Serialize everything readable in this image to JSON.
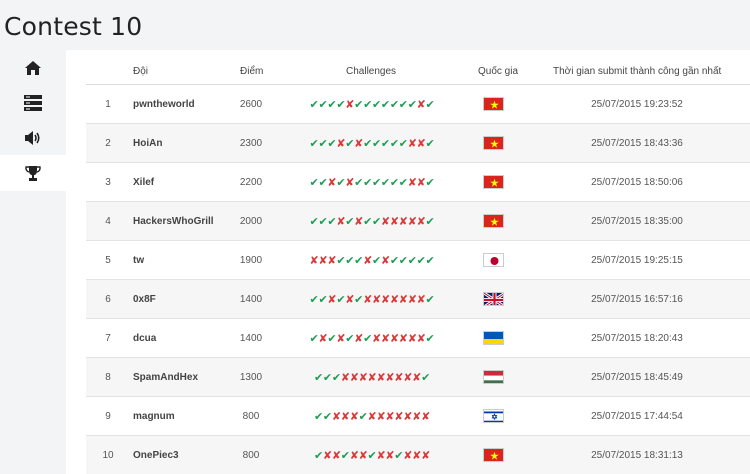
{
  "page": {
    "title": "Contest 10"
  },
  "sidebar": {
    "items": [
      {
        "icon": "home-icon",
        "active": false
      },
      {
        "icon": "server-icon",
        "active": false
      },
      {
        "icon": "speaker-icon",
        "active": false
      },
      {
        "icon": "trophy-icon",
        "active": true
      }
    ]
  },
  "scoreboard": {
    "headers": {
      "team": "Đội",
      "score": "Điểm",
      "challenges": "Challenges",
      "country": "Quốc gia",
      "last_submit": "Thời gian submit thành công gần nhất"
    },
    "rows": [
      {
        "rank": "1",
        "team": "pwntheworld",
        "score": "2600",
        "challenges": "✔✔✔✔✘✔✔✔✔✔✔✔✘✔",
        "country_flag": "vietnam",
        "time": "25/07/2015 19:23:52"
      },
      {
        "rank": "2",
        "team": "HoiAn",
        "score": "2300",
        "challenges": "✔✔✔✘✔✘✔✔✔✔✔✘✘✔",
        "country_flag": "vietnam",
        "time": "25/07/2015 18:43:36"
      },
      {
        "rank": "3",
        "team": "Xilef",
        "score": "2200",
        "challenges": "✔✔✘✔✘✔✔✔✔✔✔✘✘✔",
        "country_flag": "vietnam",
        "time": "25/07/2015 18:50:06"
      },
      {
        "rank": "4",
        "team": "HackersWhoGrill",
        "score": "2000",
        "challenges": "✔✔✔✘✔✘✔✔✘✘✘✘✘✔",
        "country_flag": "vietnam",
        "time": "25/07/2015 18:35:00"
      },
      {
        "rank": "5",
        "team": "tw",
        "score": "1900",
        "challenges": "✘✘✘✔✔✔✘✔✘✔✔✔✔✔",
        "country_flag": "japan",
        "time": "25/07/2015 19:25:15"
      },
      {
        "rank": "6",
        "team": "0x8F",
        "score": "1400",
        "challenges": "✔✔✘✔✘✔✘✘✘✘✘✘✘✔",
        "country_flag": "uk",
        "time": "25/07/2015 16:57:16"
      },
      {
        "rank": "7",
        "team": "dcua",
        "score": "1400",
        "challenges": "✔✘✔✘✔✘✔✘✘✘✘✘✘✔",
        "country_flag": "ukraine",
        "time": "25/07/2015 18:20:43"
      },
      {
        "rank": "8",
        "team": "SpamAndHex",
        "score": "1300",
        "challenges": "✔✔✔✘✘✘✘✘✘✘✘✘✔",
        "country_flag": "hungary",
        "time": "25/07/2015 18:45:49"
      },
      {
        "rank": "9",
        "team": "magnum",
        "score": "800",
        "challenges": "✔✔✘✘✘✔✘✘✘✘✘✘✘",
        "country_flag": "israel",
        "time": "25/07/2015 17:44:54"
      },
      {
        "rank": "10",
        "team": "OnePiec3",
        "score": "800",
        "challenges": "✔✘✘✔✘✘✔✘✘✔✘✘✘",
        "country_flag": "vietnam",
        "time": "25/07/2015 18:31:13"
      }
    ]
  },
  "colors": {
    "ok": "#1a9d52",
    "bad": "#d83a3a",
    "sidebar_bg": "#f3f4f6",
    "row_alt_bg": "#f6f6f6"
  }
}
